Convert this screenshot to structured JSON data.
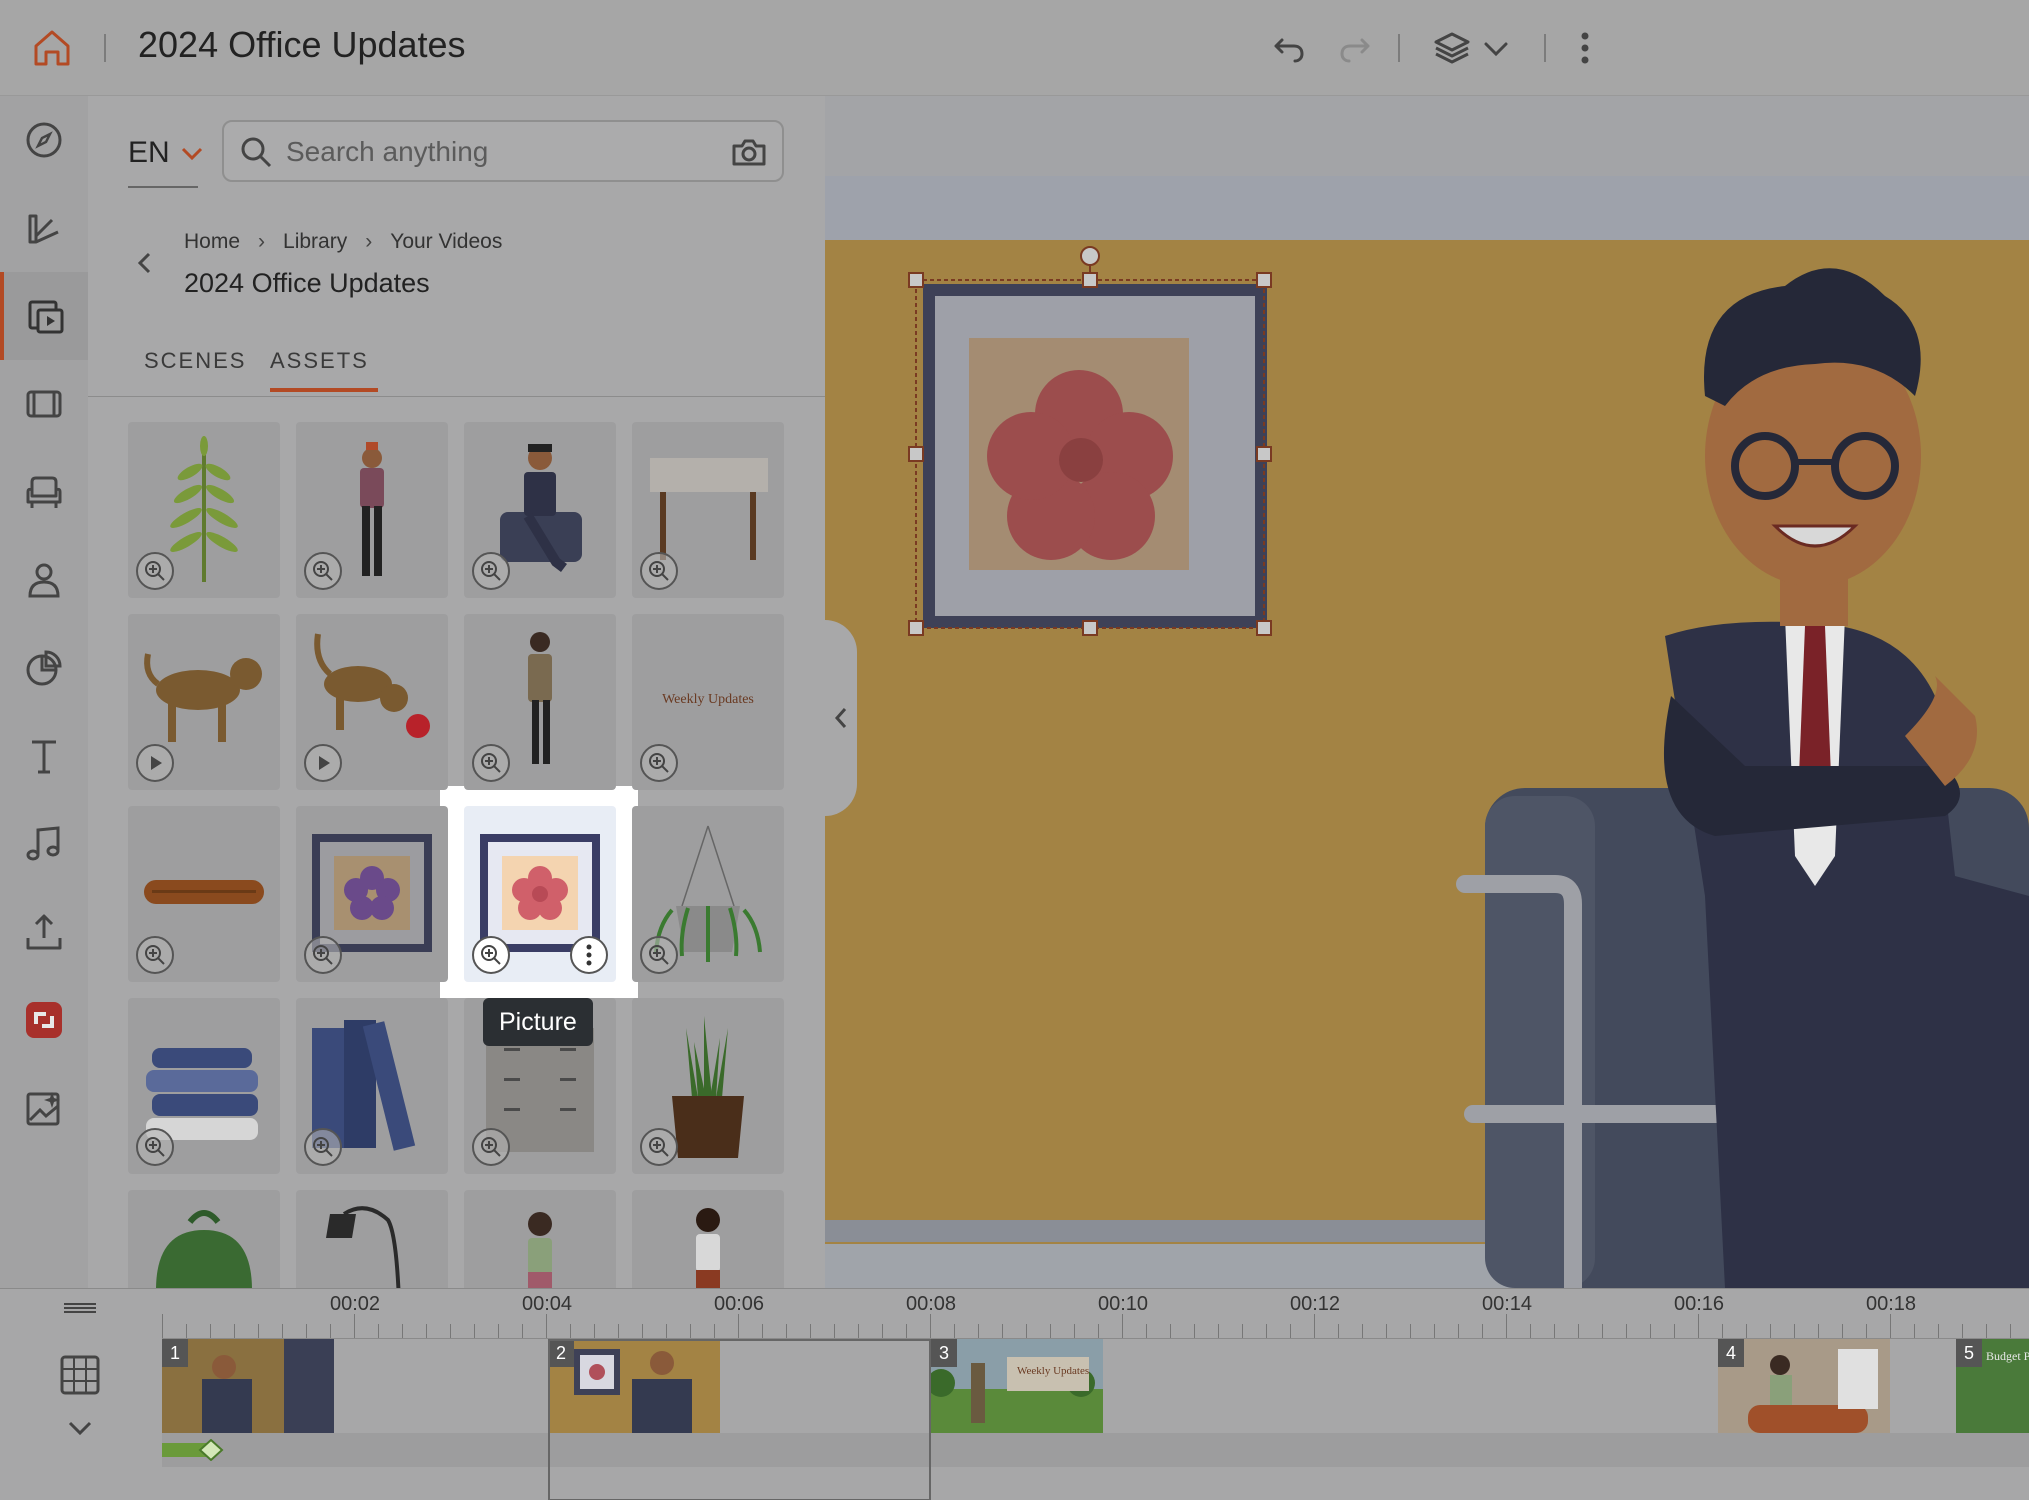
{
  "header": {
    "title": "2024 Office Updates"
  },
  "panel": {
    "language": "EN",
    "search_placeholder": "Search anything",
    "breadcrumb": [
      "Home",
      "Library",
      "Your Videos"
    ],
    "folder_title": "2024 Office Updates",
    "tabs": [
      {
        "label": "SCENES",
        "active": false
      },
      {
        "label": "ASSETS",
        "active": true
      }
    ],
    "tooltip": "Picture",
    "weekly_updates_text": "Weekly Updates"
  },
  "rail": {
    "items": [
      "compass-icon",
      "brush-palette-icon",
      "library-video-icon",
      "film-icon",
      "armchair-icon",
      "person-icon",
      "pie-chart-icon",
      "text-icon",
      "music-icon",
      "upload-icon",
      "brand-app-icon",
      "image-sparkle-icon"
    ]
  },
  "timeline": {
    "time_labels": [
      "00:02",
      "00:04",
      "00:06",
      "00:08",
      "00:10",
      "00:12",
      "00:14",
      "00:16",
      "00:18"
    ],
    "scenes": [
      {
        "num": "1"
      },
      {
        "num": "2"
      },
      {
        "num": "3",
        "text": "Weekly Updates"
      },
      {
        "num": "4"
      },
      {
        "num": "5",
        "text": "Budget Plan"
      }
    ]
  },
  "colors": {
    "accent": "#b34a24",
    "wall": "#a38344"
  }
}
